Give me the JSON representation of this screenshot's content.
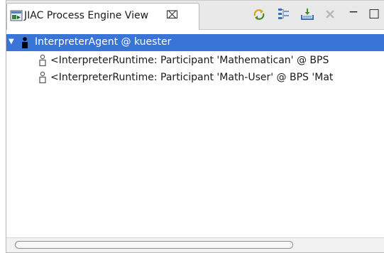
{
  "tab": {
    "title": "JIAC Process Engine View",
    "close_symbol": "⌧",
    "icon": "process-engine-view-icon"
  },
  "toolbar": {
    "buttons": [
      {
        "icon": "refresh-icon"
      },
      {
        "icon": "tree-layout-icon"
      },
      {
        "icon": "import-icon"
      },
      {
        "icon": "remove-icon"
      }
    ],
    "minimize_symbol": "−",
    "maximize_symbol": "□"
  },
  "tree": {
    "root": {
      "label": "InterpreterAgent @ kuester",
      "expanded": true,
      "selected": true,
      "icon": "agent-icon"
    },
    "children": [
      {
        "label": "<InterpreterRuntime: Participant 'Mathematican' @ BPS",
        "icon": "participant-icon"
      },
      {
        "label": "<InterpreterRuntime: Participant 'Math-User' @ BPS 'Mat",
        "icon": "participant-icon"
      }
    ]
  },
  "colors": {
    "selection": "#3875d7",
    "tab_background": "#ffffff",
    "tab_strip": "#e9e9e9"
  }
}
